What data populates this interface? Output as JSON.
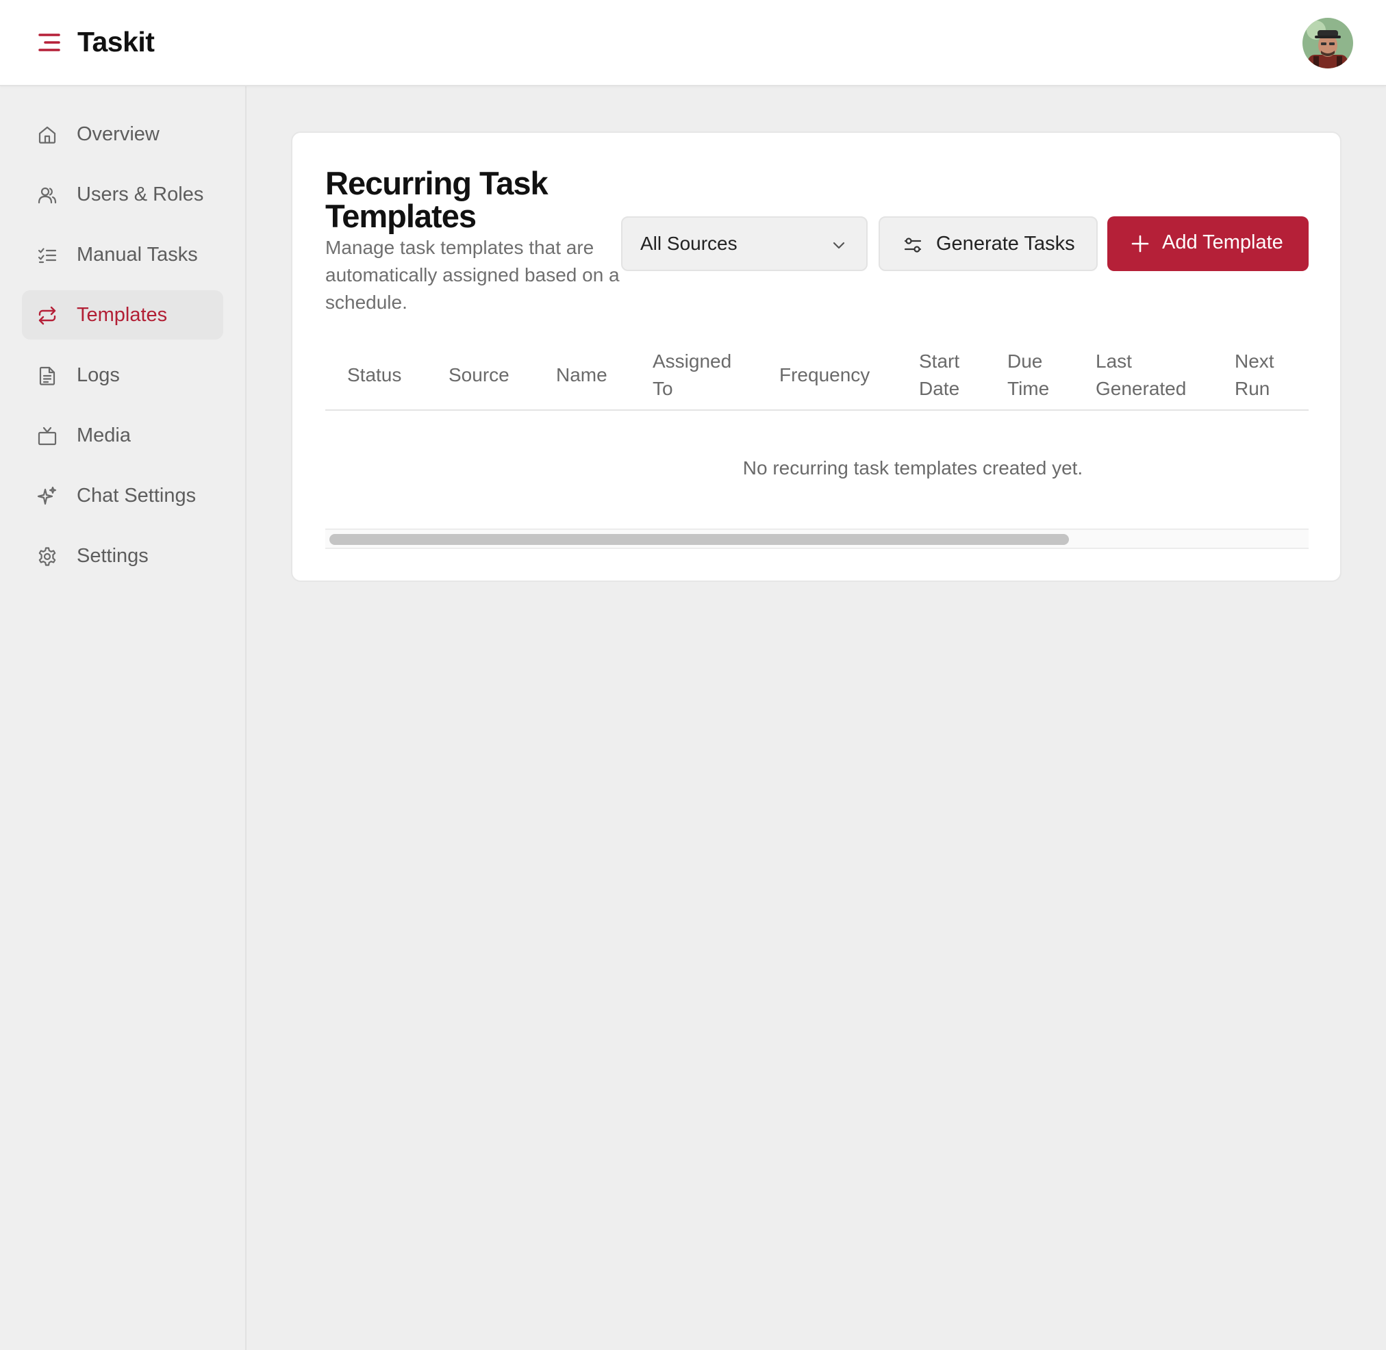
{
  "app": {
    "title": "Taskit"
  },
  "header": {
    "avatar_alt": "user-avatar"
  },
  "sidebar": {
    "items": [
      {
        "label": "Overview",
        "icon": "home-icon",
        "active": false
      },
      {
        "label": "Users & Roles",
        "icon": "users-icon",
        "active": false
      },
      {
        "label": "Manual Tasks",
        "icon": "checklist-icon",
        "active": false
      },
      {
        "label": "Templates",
        "icon": "repeat-icon",
        "active": true
      },
      {
        "label": "Logs",
        "icon": "document-icon",
        "active": false
      },
      {
        "label": "Media",
        "icon": "tv-icon",
        "active": false
      },
      {
        "label": "Chat Settings",
        "icon": "sparkles-icon",
        "active": false
      },
      {
        "label": "Settings",
        "icon": "gear-icon",
        "active": false
      }
    ]
  },
  "main": {
    "title": "Recurring Task Templates",
    "subtitle": "Manage task templates that are automatically assigned based on a schedule.",
    "source_filter": {
      "selected": "All Sources"
    },
    "generate_button": "Generate Tasks",
    "add_button": "Add Template",
    "table": {
      "columns": [
        "Status",
        "Source",
        "Name",
        "Assigned To",
        "Frequency",
        "Start Date",
        "Due Time",
        "Last Generated",
        "Next Run"
      ],
      "empty_message": "No recurring task templates created yet."
    }
  },
  "colors": {
    "accent": "#b52038",
    "active_nav_bg": "#e6e6e6",
    "page_bg": "#eeeeee"
  }
}
